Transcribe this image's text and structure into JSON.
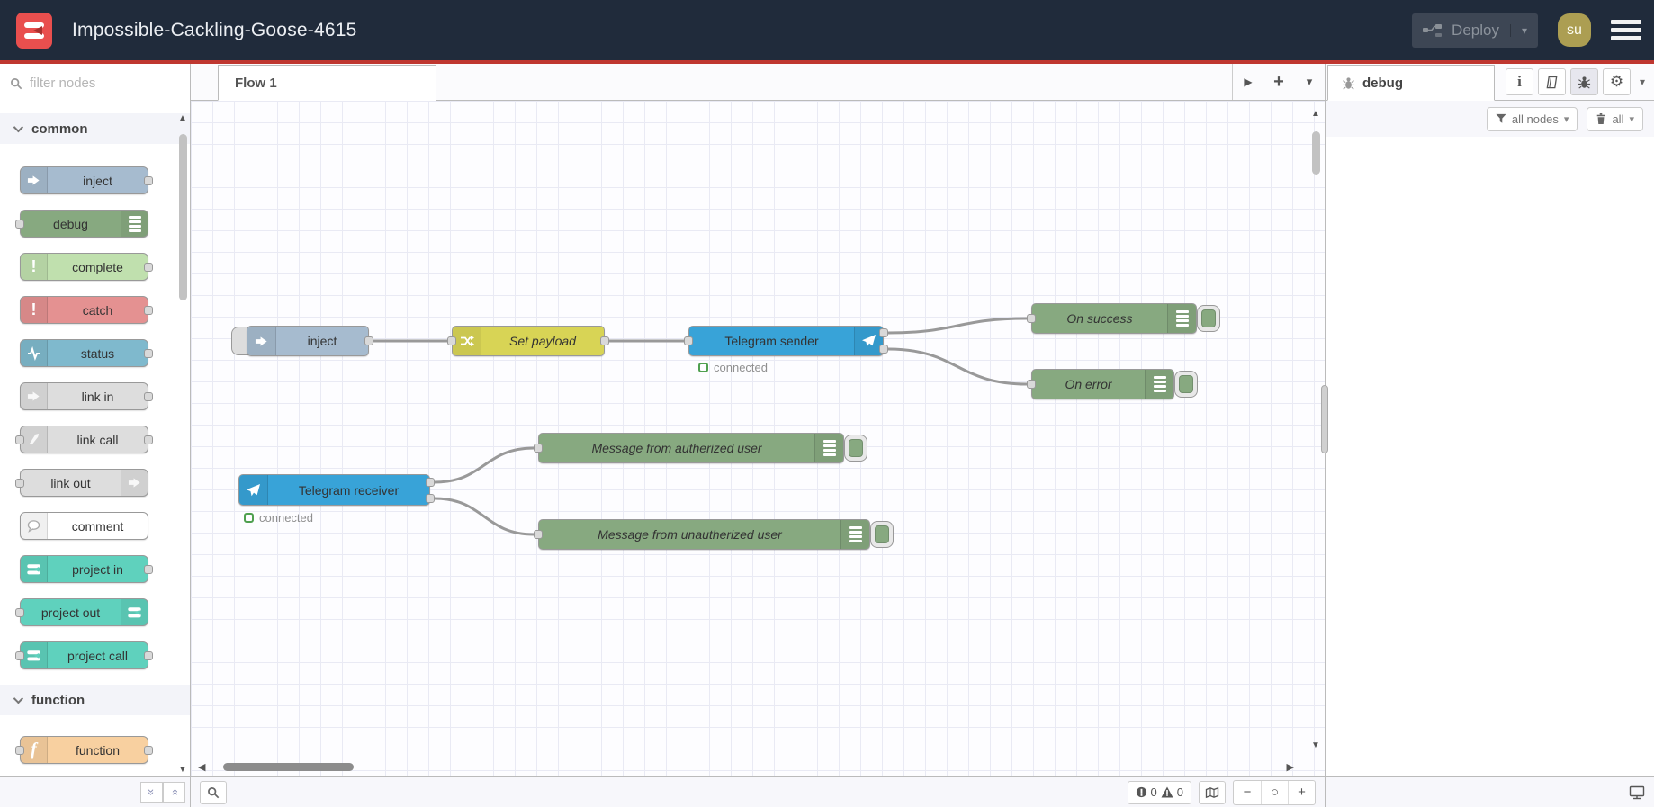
{
  "header": {
    "title": "Impossible-Cackling-Goose-4615",
    "deploy": {
      "label": "Deploy"
    },
    "avatar": {
      "initials": "su"
    }
  },
  "palette": {
    "filter_placeholder": "filter nodes",
    "categories": [
      {
        "label": "common"
      },
      {
        "label": "function"
      }
    ],
    "common_nodes": [
      {
        "label": "inject",
        "color": "#a6bbcf"
      },
      {
        "label": "debug",
        "color": "#87a980"
      },
      {
        "label": "complete",
        "color": "#c0e0ae"
      },
      {
        "label": "catch",
        "color": "#e49191"
      },
      {
        "label": "status",
        "color": "#7fb9cd"
      },
      {
        "label": "link in",
        "color": "#dddddd"
      },
      {
        "label": "link call",
        "color": "#dddddd"
      },
      {
        "label": "link out",
        "color": "#dddddd"
      },
      {
        "label": "comment",
        "color": "#ffffff"
      },
      {
        "label": "project in",
        "color": "#5fd1bd"
      },
      {
        "label": "project out",
        "color": "#5fd1bd"
      },
      {
        "label": "project call",
        "color": "#5fd1bd"
      }
    ],
    "function_nodes": [
      {
        "label": "function",
        "color": "#f8d0a0"
      }
    ]
  },
  "workspace": {
    "tabs": [
      {
        "label": "Flow 1",
        "active": true
      }
    ],
    "flow": {
      "nodes": [
        {
          "label": "inject",
          "color": "#a6bbcf"
        },
        {
          "label": "Set payload",
          "color": "#d8d455"
        },
        {
          "label": "Telegram sender",
          "color": "#38a3d8",
          "status": "connected"
        },
        {
          "label": "On success",
          "color": "#87a980"
        },
        {
          "label": "On error",
          "color": "#87a980"
        },
        {
          "label": "Telegram receiver",
          "color": "#38a3d8",
          "status": "connected"
        },
        {
          "label": "Message from autherized user",
          "color": "#87a980"
        },
        {
          "label": "Message from unautherized user",
          "color": "#87a980"
        }
      ]
    },
    "footer": {
      "error_count": "0",
      "warning_count": "0"
    }
  },
  "sidebar": {
    "tab_label": "debug",
    "filter_button": "all nodes",
    "clear_button": "all"
  },
  "colors": {
    "header_bg": "#202b3b",
    "accent_red": "#bf3730",
    "logo_red": "#e94f4e",
    "status_green": "#4fa04f",
    "wire_gray": "#999999",
    "avatar_gold": "#ac9e52"
  }
}
